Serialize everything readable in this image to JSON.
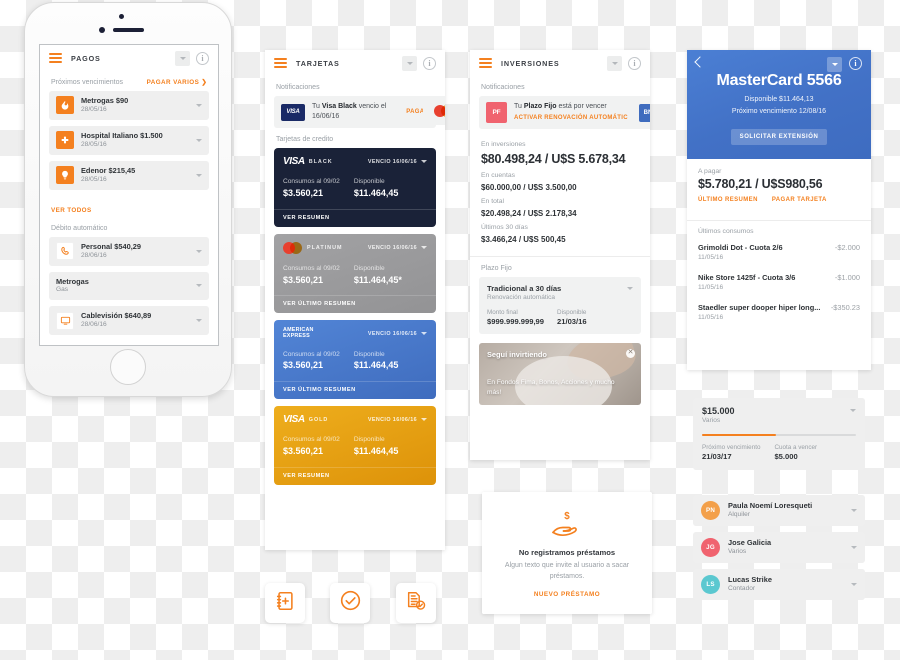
{
  "screens": {
    "pagos": {
      "title": "PAGOS",
      "section1_label": "Próximos vencimientos",
      "section1_action": "PAGAR VARIOS ❯",
      "items1": [
        {
          "icon": "flame-icon",
          "title": "Metrogas $90",
          "sub": "28/05/16"
        },
        {
          "icon": "medical-cross-icon",
          "title": "Hospital Italiano $1.500",
          "sub": "28/05/16"
        },
        {
          "icon": "lightbulb-icon",
          "title": "Edenor $215,45",
          "sub": "28/05/16"
        }
      ],
      "see_all": "VER TODOS",
      "section2_label": "Débito automático",
      "items2": [
        {
          "icon": "phone-icon",
          "title": "Personal $540,29",
          "sub": "28/06/16",
          "white": true
        },
        {
          "icon": "none",
          "title": "Metrogas",
          "sub": "Gas",
          "white": false
        },
        {
          "icon": "tv-icon",
          "title": "Cablevisión $640,89",
          "sub": "28/06/16",
          "white": true
        }
      ]
    },
    "tarjetas": {
      "title": "TARJETAS",
      "notif_label": "Notificaciones",
      "notif": {
        "logo": "VISA",
        "text_pre": "Tu ",
        "text_bold": "Visa Black",
        "text_post": " vencio el 16/06/16",
        "action": "PAGAR"
      },
      "cards_label": "Tarjetas de credito",
      "labels": {
        "consumos": "Consumos al 09/02",
        "disponible": "Disponible"
      },
      "cards": [
        {
          "brand": "VISA",
          "sub": "BLACK",
          "exp": "VENCIO 16/06/16",
          "consumos": "$3.560,21",
          "disponible": "$11.464,45",
          "foot": "VER RESUMEN",
          "theme": "black"
        },
        {
          "brand": "mastercard-icon",
          "sub": "PLATINUM",
          "exp": "VENCIO 16/06/16",
          "consumos": "$3.560,21",
          "disponible": "$11.464,45*",
          "foot": "VER ÚLTIMO RESUMEN",
          "theme": "platinum"
        },
        {
          "brand": "AMERICAN EXPRESS",
          "sub": "",
          "exp": "VENCIO 16/06/16",
          "consumos": "$3.560,21",
          "disponible": "$11.464,45",
          "foot": "VER ÚLTIMO RESUMEN",
          "theme": "amex"
        },
        {
          "brand": "VISA",
          "sub": "GOLD",
          "exp": "VENCIO 16/06/16",
          "consumos": "$3.560,21",
          "disponible": "$11.464,45",
          "foot": "VER RESUMEN",
          "theme": "gold"
        }
      ]
    },
    "inversiones": {
      "title": "INVERSIONES",
      "notif_label": "Notificaciones",
      "notif": {
        "badge": "PF",
        "text_pre": "Tu ",
        "text_bold": "Plazo Fijo",
        "text_post": " está por vencer",
        "action": "ACTIVAR RENOVACIÓN AUTOMÁTICA",
        "side_badge": "BN"
      },
      "stats": [
        {
          "label": "En inversiones",
          "value": "$80.498,24  /  U$S 5.678,34",
          "big": true
        },
        {
          "label": "En cuentas",
          "value": "$60.000,00  /  U$S 3.500,00",
          "big": false
        },
        {
          "label": "En total",
          "value": "$20.498,24  /  U$S 2.178,34",
          "big": false
        },
        {
          "label": "Últimos 30 días",
          "value": "$3.466,24  /  U$S 500,45",
          "big": false
        }
      ],
      "pf_label": "Plazo Fijo",
      "pf": {
        "title": "Tradicional a 30 días",
        "sub": "Renovación automática",
        "col1_label": "Monto final",
        "col1_value": "$999.999.999,99",
        "col2_label": "Disponible",
        "col2_value": "21/03/16"
      },
      "promo": {
        "title": "Seguí invirtiendo",
        "subtitle": "En Fondos Fima, Bonos, Acciones y mucho más!",
        "close": "✕"
      },
      "loans_empty": {
        "icon": "hand-with-money-icon",
        "title": "No registramos préstamos",
        "text": "Algun texto que invite al usuario a sacar préstamos.",
        "cta": "NUEVO PRÉSTAMO"
      }
    },
    "mastercard": {
      "title": "MasterCard 5566",
      "available": "Disponible $11.464,13",
      "next_due": "Próximo vencimiento 12/08/16",
      "cta": "SOLICITAR EXTENSIÓN",
      "pay_label": "A pagar",
      "pay_value": "$5.780,21  /  U$S980,56",
      "links": [
        "ÚLTIMO RESUMEN",
        "PAGAR TARJETA"
      ],
      "tx_label": "Últimos consumos",
      "transactions": [
        {
          "name": "Grimoldi Dot - Cuota 2/6",
          "date": "11/05/16",
          "amount": "-$2.000"
        },
        {
          "name": "Nike Store 1425f - Cuota 3/6",
          "date": "11/05/16",
          "amount": "-$1.000"
        },
        {
          "name": "Staedler super dooper hiper long...",
          "date": "11/05/16",
          "amount": "-$350.23"
        }
      ]
    },
    "loan_progress": {
      "amount": "$15.000",
      "sub": "Varios",
      "progress_pct": 48,
      "col1_label": "Próximo vencimiento",
      "col1_value": "21/03/17",
      "col2_label": "Cuota a vencer",
      "col2_value": "$5.000"
    },
    "contacts": [
      {
        "initials": "PN",
        "name": "Paula Noemí Loresqueti",
        "sub": "Alquiler",
        "color": "#f3a04a"
      },
      {
        "initials": "JG",
        "name": "Jose Galicia",
        "sub": "Varios",
        "color": "#f0636f"
      },
      {
        "initials": "LS",
        "name": "Lucas Strike",
        "sub": "Contador",
        "color": "#5bc8d0"
      }
    ],
    "tiles": [
      {
        "icon": "add-contact-book-icon"
      },
      {
        "icon": "check-circle-icon"
      },
      {
        "icon": "documents-check-icon"
      }
    ]
  },
  "colors": {
    "accent": "#f4801f",
    "visa_black": "#1a2238",
    "platinum": "#9a9a9c",
    "amex": "#4277c8",
    "gold": "#e5a117",
    "blue_hero": "#4271c6"
  }
}
